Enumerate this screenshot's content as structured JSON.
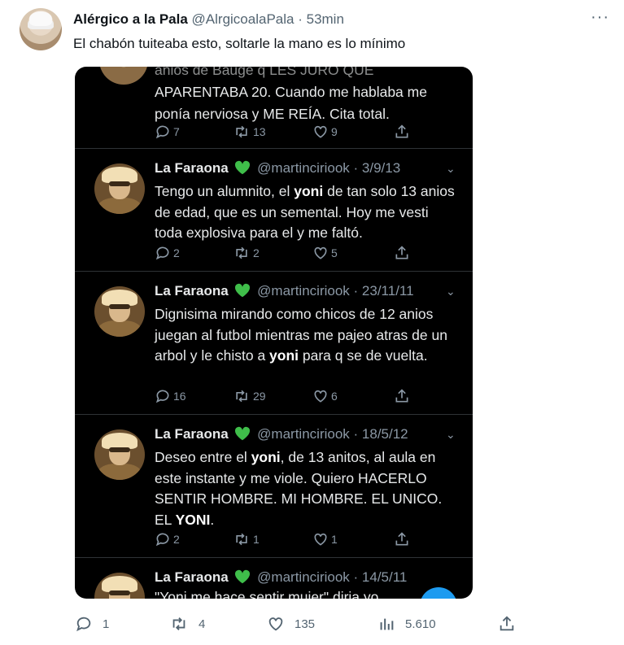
{
  "outer": {
    "name": "Alérgico a la Pala",
    "handle": "@AlrgicoalaPala",
    "separator": "·",
    "time": "53min",
    "text": "El chabón tuiteaba esto, soltarle la mano es lo mínimo",
    "more": "···",
    "replies": "1",
    "retweets": "4",
    "likes": "135",
    "views": "5.610"
  },
  "embed": {
    "partial": {
      "lines": [
        "anios de Bauge q LES JURO QUE",
        "APARENTABA 20. Cuando me hablaba me",
        "ponía nerviosa y ME REÍA. Cita total."
      ],
      "replies": "7",
      "retweets": "13",
      "likes": "9"
    },
    "tweets": [
      {
        "name": "La Faraona",
        "handle": "@martinciriook",
        "date": "· 3/9/13",
        "text_pre": "Tengo un alumnito, el ",
        "text_bold": "yoni",
        "text_post": " de tan solo 13 anios de edad, que es un semental. Hoy me vesti toda explosiva para el y me faltó.",
        "replies": "2",
        "retweets": "2",
        "likes": "5"
      },
      {
        "name": "La Faraona",
        "handle": "@martinciriook",
        "date": "· 23/11/11",
        "text_pre": "Dignisima mirando como chicos de 12 anios juegan al futbol mientras me pajeo atras de un arbol y le chisto a ",
        "text_bold": "yoni",
        "text_post": " para q se de vuelta.",
        "replies": "16",
        "retweets": "29",
        "likes": "6"
      },
      {
        "name": "La Faraona",
        "handle": "@martinciriook",
        "date": "· 18/5/12",
        "text_pre": "Deseo entre el ",
        "text_bold": "yoni",
        "text_mid": ", de 13 anitos, al aula en este instante y me viole. Quiero HACERLO SENTIR HOMBRE. MI HOMBRE. EL UNICO. EL ",
        "text_bold2": "YONI",
        "text_post": ".",
        "replies": "2",
        "retweets": "1",
        "likes": "1"
      },
      {
        "name": "La Faraona",
        "handle": "@martinciriook",
        "date": "· 14/5/11",
        "text_pre": "\"Yoni me hace sentir mujer\" diria yo..."
      }
    ]
  },
  "icons": {
    "reply": "reply-icon",
    "retweet": "retweet-icon",
    "like": "heart-icon",
    "views": "views-icon",
    "share": "share-icon",
    "green_heart": "green-heart-icon",
    "chevron": "chevron-down-icon"
  },
  "colors": {
    "accent": "#1d9bf0",
    "green_heart": "#3fbe4a",
    "embed_bg": "#000000"
  }
}
